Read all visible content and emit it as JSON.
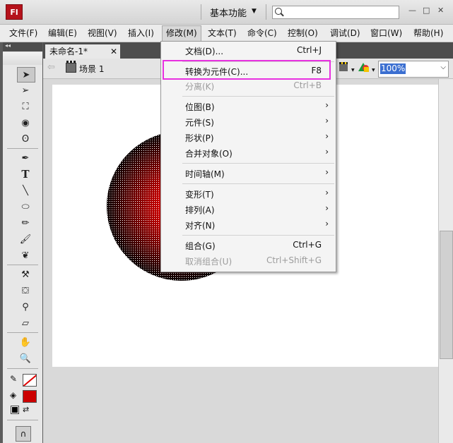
{
  "title_bar": {
    "logo_text": "Fl",
    "workspace": "基本功能",
    "search_placeholder": "",
    "window_buttons": [
      "—",
      "□",
      "✕"
    ]
  },
  "menubar": {
    "items": [
      "文件(F)",
      "编辑(E)",
      "视图(V)",
      "插入(I)",
      "修改(M)",
      "文本(T)",
      "命令(C)",
      "控制(O)",
      "调试(D)",
      "窗口(W)",
      "帮助(H)"
    ],
    "active": "修改(M)"
  },
  "document": {
    "tab_label": "未命名-1*",
    "scene": "场景 1",
    "zoom": "100%"
  },
  "modify_menu": {
    "items": [
      {
        "label": "文档(D)...",
        "shortcut": "Ctrl+J"
      },
      {
        "label": "转换为元件(C)...",
        "shortcut": "F8",
        "highlighted": true
      },
      {
        "label": "分离(K)",
        "shortcut": "Ctrl+B",
        "disabled": true
      },
      {
        "label": "位图(B)",
        "submenu": true
      },
      {
        "label": "元件(S)",
        "submenu": true
      },
      {
        "label": "形状(P)",
        "submenu": true
      },
      {
        "label": "合并对象(O)",
        "submenu": true
      },
      {
        "label": "时间轴(M)",
        "submenu": true
      },
      {
        "label": "变形(T)",
        "submenu": true
      },
      {
        "label": "排列(A)",
        "submenu": true
      },
      {
        "label": "对齐(N)",
        "submenu": true
      },
      {
        "label": "组合(G)",
        "shortcut": "Ctrl+G"
      },
      {
        "label": "取消组合(U)",
        "shortcut": "Ctrl+Shift+G",
        "disabled": true
      }
    ],
    "highlight_color": "#e830e0"
  },
  "colors": {
    "stroke_color": "none",
    "fill_color": "#cc0000"
  },
  "stage_content": {
    "shape": "circle",
    "fill": "radial red-to-black gradient with dotted selection pattern"
  }
}
